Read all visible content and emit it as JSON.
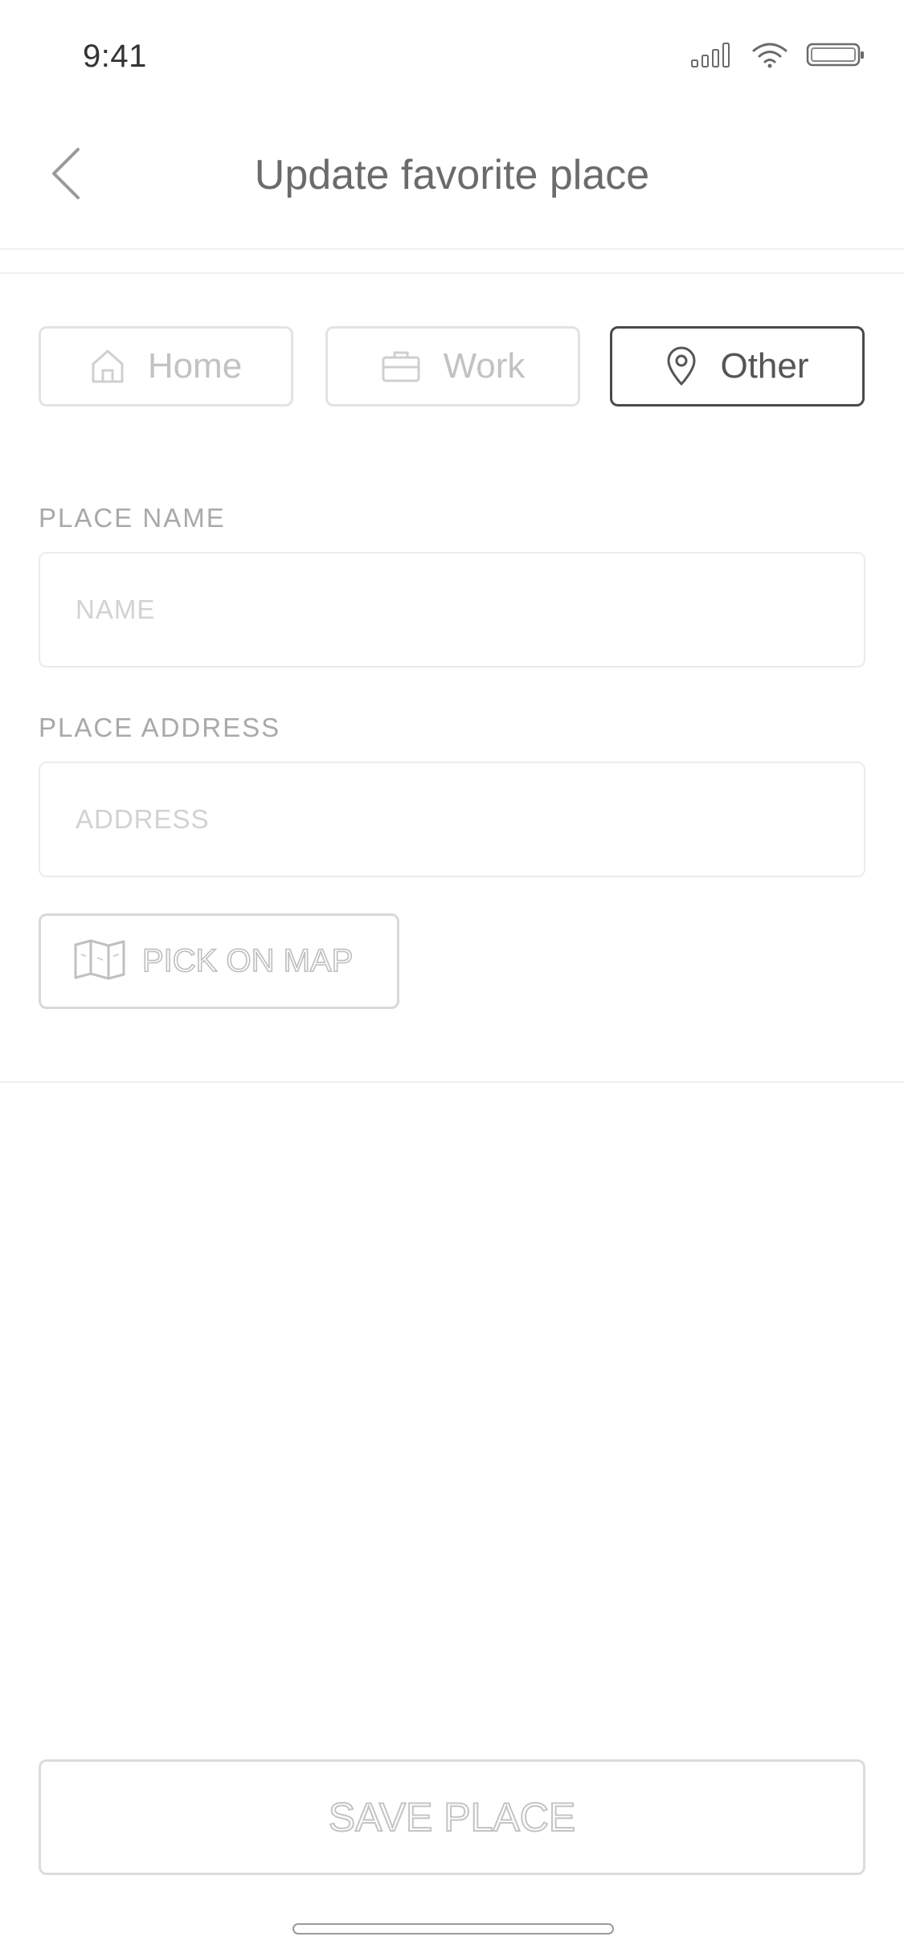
{
  "status_bar": {
    "time": "9:41",
    "icons": [
      "cellular-signal-icon",
      "wifi-icon",
      "battery-icon"
    ]
  },
  "header": {
    "back_icon": "chevron-left-icon",
    "title": "Update favorite place"
  },
  "place_types": {
    "selected": "Other",
    "items": [
      {
        "label": "Home",
        "icon": "home-icon",
        "selected": false
      },
      {
        "label": "Work",
        "icon": "briefcase-icon",
        "selected": false
      },
      {
        "label": "Other",
        "icon": "map-pin-icon",
        "selected": true
      }
    ]
  },
  "form": {
    "name_label": "PLACE NAME",
    "name_placeholder": "NAME",
    "name_value": "",
    "address_label": "PLACE ADDRESS",
    "address_placeholder": "ADDRESS",
    "address_value": "",
    "pick_on_map_label": "PICK ON MAP",
    "pick_on_map_icon": "folded-map-icon"
  },
  "footer": {
    "save_label": "SAVE PLACE"
  },
  "colors": {
    "background": "#ffffff",
    "selected_border": "#4a4a4a",
    "unselected_border": "#e3e3e3",
    "muted_text": "#c2c2c2"
  }
}
